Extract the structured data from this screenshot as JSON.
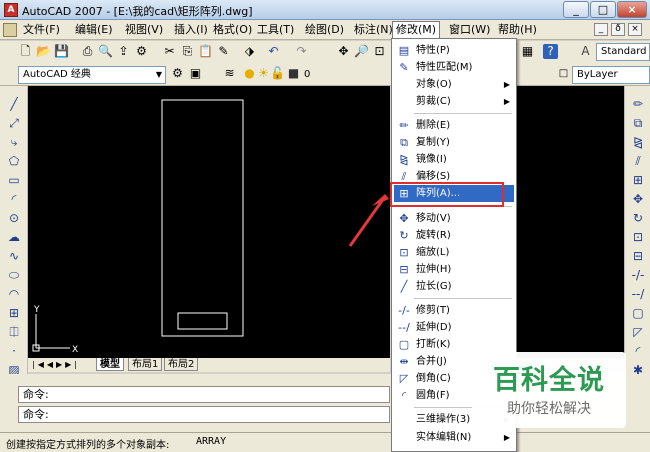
{
  "window": {
    "title": "AutoCAD 2007 - [E:\\我的cad\\矩形阵列.dwg]",
    "app_icon": "autocad-logo",
    "controls": [
      "_",
      "□",
      "×"
    ]
  },
  "menubar": {
    "items": [
      "文件(F)",
      "编辑(E)",
      "视图(V)",
      "插入(I)",
      "格式(O)",
      "工具(T)",
      "绘图(D)",
      "标注(N)",
      "修改(M)",
      "窗口(W)",
      "帮助(H)"
    ],
    "doc_controls": [
      "_",
      "ð",
      "×"
    ]
  },
  "toolbar": {
    "workspace": "AutoCAD 经典",
    "layer_value": "0",
    "text_style": "Standard",
    "linetype": "ByLayer"
  },
  "modify_menu": {
    "items": [
      {
        "label": "特性(P)",
        "icon": "properties-icon"
      },
      {
        "label": "特性匹配(M)",
        "icon": "match-properties-icon"
      },
      {
        "label": "对象(O)",
        "submenu": true
      },
      {
        "label": "剪裁(C)",
        "submenu": true
      },
      {
        "label": "删除(E)",
        "icon": "erase-icon"
      },
      {
        "label": "复制(Y)",
        "icon": "copy-icon"
      },
      {
        "label": "镜像(I)",
        "icon": "mirror-icon"
      },
      {
        "label": "偏移(S)",
        "icon": "offset-icon"
      },
      {
        "label": "阵列(A)...",
        "icon": "array-icon",
        "highlighted": true
      },
      {
        "label": "移动(V)",
        "icon": "move-icon"
      },
      {
        "label": "旋转(R)",
        "icon": "rotate-icon"
      },
      {
        "label": "缩放(L)",
        "icon": "scale-icon"
      },
      {
        "label": "拉伸(H)",
        "icon": "stretch-icon"
      },
      {
        "label": "拉长(G)",
        "icon": "lengthen-icon"
      },
      {
        "label": "修剪(T)",
        "icon": "trim-icon"
      },
      {
        "label": "延伸(D)",
        "icon": "extend-icon"
      },
      {
        "label": "打断(K)",
        "icon": "break-icon"
      },
      {
        "label": "合并(J)",
        "icon": "join-icon"
      },
      {
        "label": "倒角(C)",
        "icon": "chamfer-icon"
      },
      {
        "label": "圆角(F)",
        "icon": "fillet-icon"
      },
      {
        "label": "三维操作(3)",
        "submenu": true
      },
      {
        "label": "实体编辑(N)",
        "submenu": true
      }
    ]
  },
  "layout_tabs": [
    "模型",
    "布局1",
    "布局2"
  ],
  "command": {
    "line1": "命令:",
    "line2": "命令:"
  },
  "status": {
    "hint": "创建按指定方式排列的多个对象副本:",
    "command": "ARRAY"
  },
  "watermark": {
    "title": "百科全说",
    "subtitle": "助你轻松解决"
  },
  "colors": {
    "highlight": "#316ac5",
    "annotation_red": "#e02d2d",
    "watermark_green": "#2c9a52"
  }
}
